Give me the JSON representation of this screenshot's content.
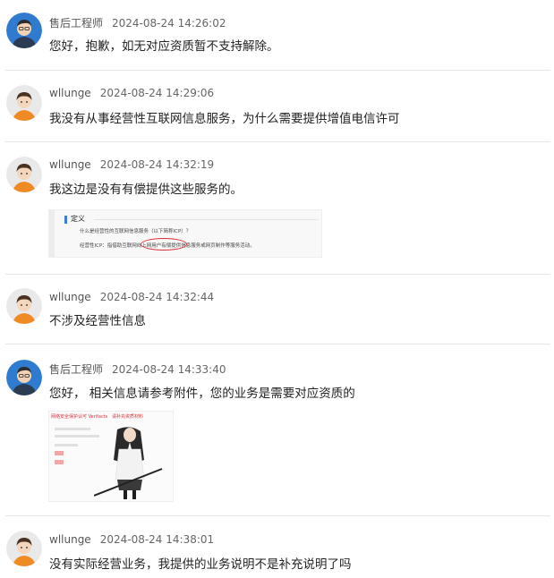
{
  "messages": [
    {
      "role": "engineer",
      "author": "售后工程师",
      "time": "2024-08-24 14:26:02",
      "text": "您好，抱歉，如无对应资质暂不支持解除。"
    },
    {
      "role": "user",
      "author": "wllunge",
      "time": "2024-08-24 14:29:06",
      "text": "我没有从事经营性互联网信息服务，为什么需要提供增值电信许可"
    },
    {
      "role": "user",
      "author": "wllunge",
      "time": "2024-08-24 14:32:19",
      "text": "我这边是没有有偿提供这些服务的。"
    },
    {
      "role": "user",
      "author": "wllunge",
      "time": "2024-08-24 14:32:44",
      "text": "不涉及经营性信息"
    },
    {
      "role": "engineer",
      "author": "售后工程师",
      "time": "2024-08-24 14:33:40",
      "text": "您好， 相关信息请参考附件，您的业务是需要对应资质的"
    },
    {
      "role": "user",
      "author": "wllunge",
      "time": "2024-08-24 14:38:01",
      "text": "没有实际经营业务，我提供的业务说明不是补充说明了吗"
    }
  ],
  "attachment1": {
    "heading": "定义",
    "question": "什么是经营性的互联网信息服务（以下简称ICP）？",
    "answer": "经营性ICP：指借助互联网向上网用户有偿提供信息服务或网页制作等服务活动。"
  },
  "attachment2": {
    "lines": [
      "网络安全保护认可 Verifacts",
      "请补充资质材料"
    ]
  },
  "colors": {
    "divider": "#e6e6e6",
    "engineer_avatar": "#3b82c4",
    "user_avatar_shirt": "#f08a24",
    "highlight": "#d9303a"
  }
}
